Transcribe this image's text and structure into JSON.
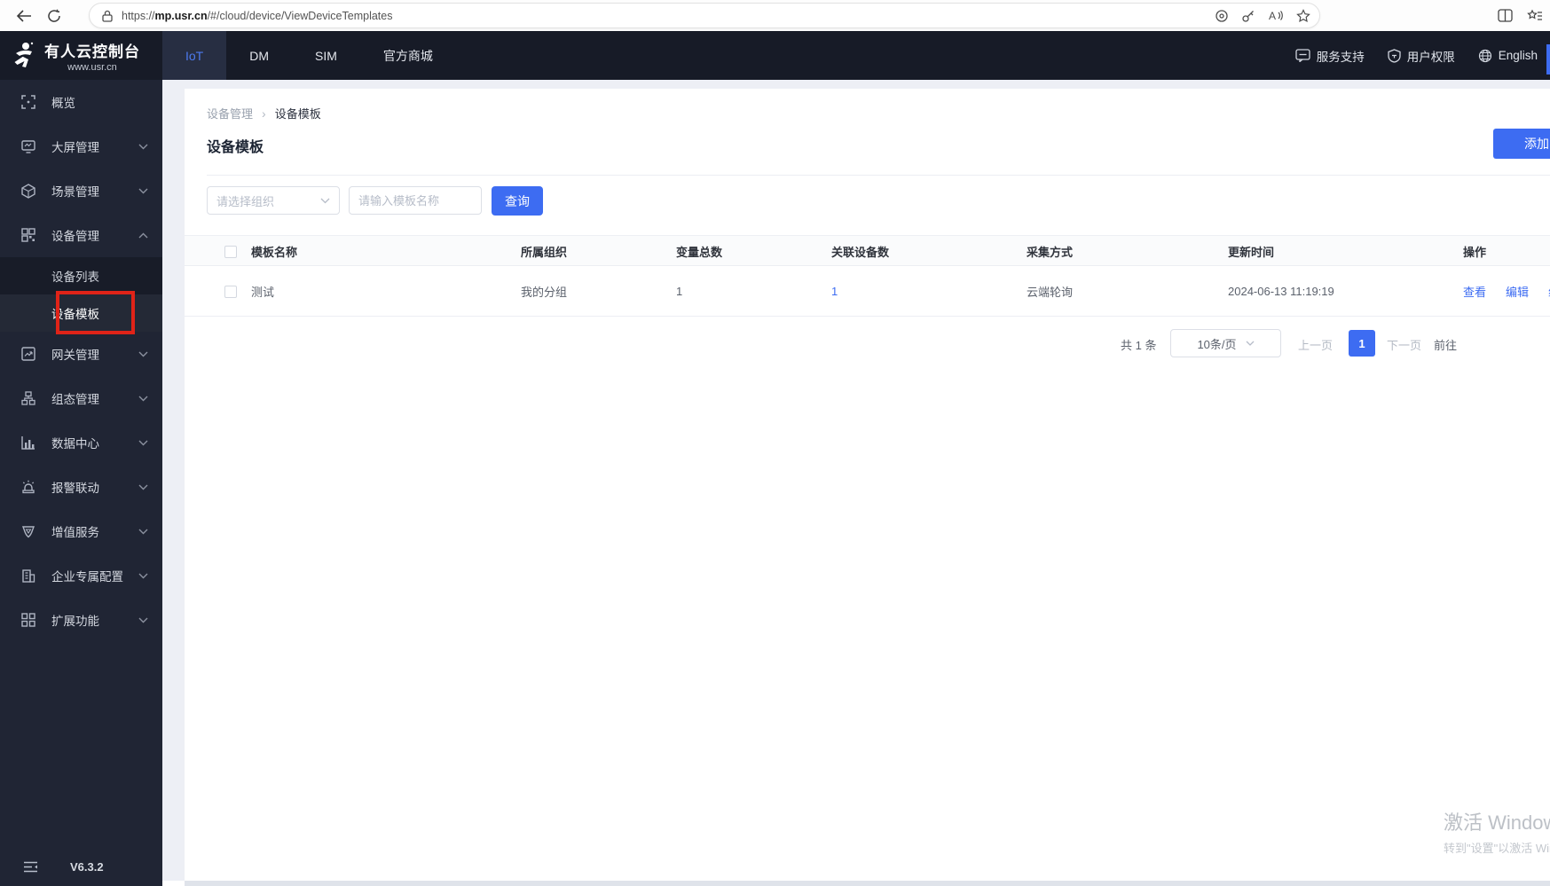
{
  "browser": {
    "url_scheme": "https://",
    "url_host": "mp.usr.cn",
    "url_path": "/#/cloud/device/ViewDeviceTemplates",
    "icons": [
      "back-icon",
      "refresh-icon",
      "lock-icon",
      "location-icon",
      "key-icon",
      "read-aloud-icon",
      "favorite-star-icon",
      "split-screen-icon",
      "collections-icon"
    ]
  },
  "header": {
    "logo_title": "有人云控制台",
    "logo_subtitle": "www.usr.cn",
    "tabs": [
      {
        "label": "IoT",
        "active": true
      },
      {
        "label": "DM",
        "active": false
      },
      {
        "label": "SIM",
        "active": false
      },
      {
        "label": "官方商城",
        "active": false
      }
    ],
    "right": {
      "support": "服务支持",
      "permissions": "用户权限",
      "language": "English"
    }
  },
  "sidebar": {
    "items": [
      {
        "label": "概览",
        "icon": "overview-icon",
        "expandable": false
      },
      {
        "label": "大屏管理",
        "icon": "bigscreen-icon",
        "expandable": true
      },
      {
        "label": "场景管理",
        "icon": "scene-cube-icon",
        "expandable": true
      },
      {
        "label": "设备管理",
        "icon": "device-grid-icon",
        "expandable": true,
        "expanded": true,
        "children": [
          {
            "label": "设备列表",
            "active": false
          },
          {
            "label": "设备模板",
            "active": true,
            "annotated": true
          }
        ]
      },
      {
        "label": "网关管理",
        "icon": "gateway-icon",
        "expandable": true
      },
      {
        "label": "组态管理",
        "icon": "hierarchy-icon",
        "expandable": true
      },
      {
        "label": "数据中心",
        "icon": "bar-chart-icon",
        "expandable": true
      },
      {
        "label": "报警联动",
        "icon": "alarm-icon",
        "expandable": true
      },
      {
        "label": "增值服务",
        "icon": "shield-gem-icon",
        "expandable": true
      },
      {
        "label": "企业专属配置",
        "icon": "building-icon",
        "expandable": true
      },
      {
        "label": "扩展功能",
        "icon": "squares-icon",
        "expandable": true
      }
    ],
    "version": "V6.3.2"
  },
  "main": {
    "breadcrumb": {
      "parent": "设备管理",
      "current": "设备模板"
    },
    "page_title": "设备模板",
    "add_button": "添加",
    "filters": {
      "org_select_placeholder": "请选择组织",
      "name_input_placeholder": "请输入模板名称",
      "search_button": "查询"
    },
    "table": {
      "columns": [
        "模板名称",
        "所属组织",
        "变量总数",
        "关联设备数",
        "采集方式",
        "更新时间",
        "操作"
      ],
      "rows": [
        {
          "name": "测试",
          "org": "我的分组",
          "var_count": "1",
          "device_count": "1",
          "collect_mode": "云端轮询",
          "updated": "2024-06-13 11:19:19",
          "action_view": "查看",
          "action_edit": "编辑",
          "action_third_partial": "组"
        }
      ]
    },
    "pagination": {
      "total": "共 1 条",
      "page_size": "10条/页",
      "prev": "上一页",
      "current": "1",
      "next": "下一页",
      "goto": "前往"
    }
  },
  "watermark": {
    "line1": "激活 Windows",
    "line2": "转到\"设置\"以激活 Windows"
  },
  "colors": {
    "accent": "#3d6cf2",
    "header_bg": "#171b27",
    "sidebar_bg": "#202534",
    "annotation_red": "#e02318"
  }
}
